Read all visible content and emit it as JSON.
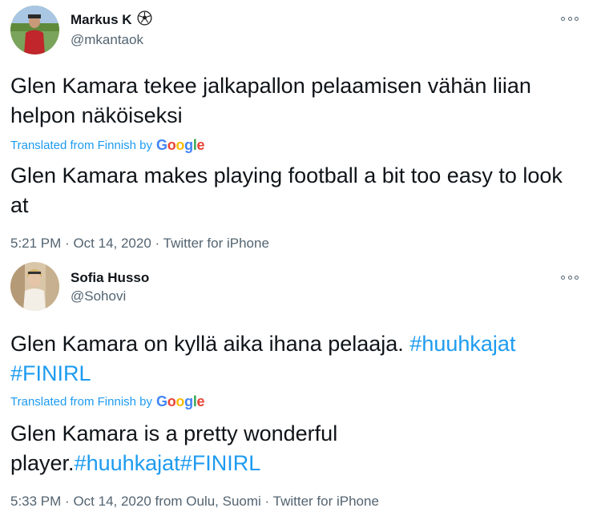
{
  "tweets": [
    {
      "name": "Markus K",
      "name_icon": "soccer-ball-icon",
      "handle": "@mkantaok",
      "text": "Glen Kamara tekee jalkapallon pelaamisen vähän liian helpon näköiseksi",
      "translated_label": "Translated from Finnish by",
      "translation": "Glen Kamara makes playing football a bit too easy to look at",
      "time": "5:21 PM",
      "date": "Oct 14, 2020",
      "location": "",
      "source": "Twitter for iPhone"
    },
    {
      "name": "Sofia Husso",
      "handle": "@Sohovi",
      "text_plain": "Glen Kamara on kyllä aika ihana pelaaja.",
      "hashtags": [
        "#huuhkajat",
        "#FINIRL"
      ],
      "translated_label": "Translated from Finnish by",
      "translation_plain": "Glen Kamara is a pretty wonderful player.",
      "translation_hashtags": [
        "#huuhkajat",
        "#FINIRL"
      ],
      "time": "5:33 PM",
      "date": "Oct 14, 2020",
      "location_prefix": "from",
      "location": "Oulu, Suomi",
      "source": "Twitter for iPhone"
    }
  ],
  "google_logo": [
    "G",
    "o",
    "o",
    "g",
    "l",
    "e"
  ],
  "meta_separator": "·",
  "colors": {
    "link": "#1d9bf0",
    "secondary_text": "#536471",
    "primary_text": "#0f1419"
  }
}
